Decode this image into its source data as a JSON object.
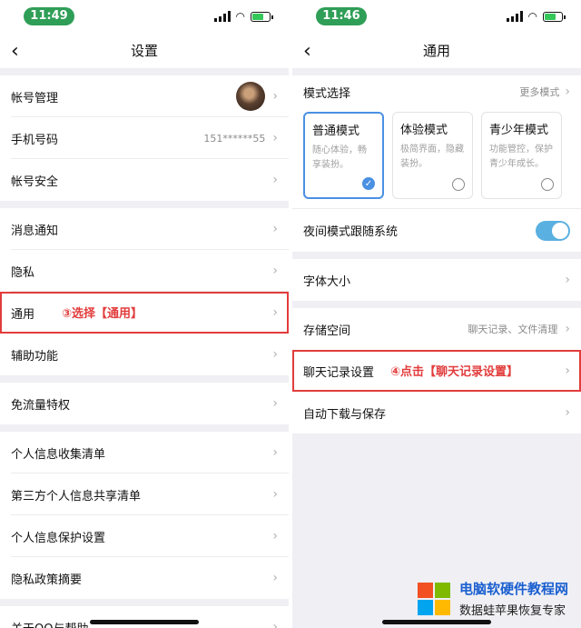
{
  "left": {
    "time": "11:49",
    "nav_title": "设置",
    "rows": [
      {
        "label": "帐号管理"
      },
      {
        "label": "手机号码",
        "value": "151******55"
      },
      {
        "label": "帐号安全"
      },
      {
        "label": "消息通知"
      },
      {
        "label": "隐私"
      },
      {
        "label": "通用"
      },
      {
        "label": "辅助功能"
      },
      {
        "label": "免流量特权"
      },
      {
        "label": "个人信息收集清单"
      },
      {
        "label": "第三方个人信息共享清单"
      },
      {
        "label": "个人信息保护设置"
      },
      {
        "label": "隐私政策摘要"
      },
      {
        "label": "关于QQ与帮助"
      }
    ],
    "annotation": "③选择【通用】"
  },
  "right": {
    "time": "11:46",
    "nav_title": "通用",
    "mode_section": {
      "label": "模式选择",
      "more": "更多模式"
    },
    "modes": [
      {
        "title": "普通模式",
        "desc": "随心体验，畅享装扮。",
        "selected": true
      },
      {
        "title": "体验模式",
        "desc": "极简界面，隐藏装扮。",
        "selected": false
      },
      {
        "title": "青少年模式",
        "desc": "功能管控，保护青少年成长。",
        "selected": false
      }
    ],
    "night_mode": {
      "label": "夜间模式跟随系统",
      "on": true
    },
    "rows": [
      {
        "label": "字体大小"
      },
      {
        "label": "存储空间",
        "value": "聊天记录、文件清理"
      },
      {
        "label": "聊天记录设置"
      },
      {
        "label": "自动下载与保存"
      }
    ],
    "annotation": "④点击【聊天记录设置】"
  },
  "watermark": {
    "line1": "电脑软硬件教程网",
    "line2": "数据蛙苹果恢复专家"
  },
  "colors": {
    "accent": "#4a90e2",
    "annotation": "#e23c3c",
    "time_pill": "#2f9e57",
    "toggle": "#5ab0e0"
  }
}
